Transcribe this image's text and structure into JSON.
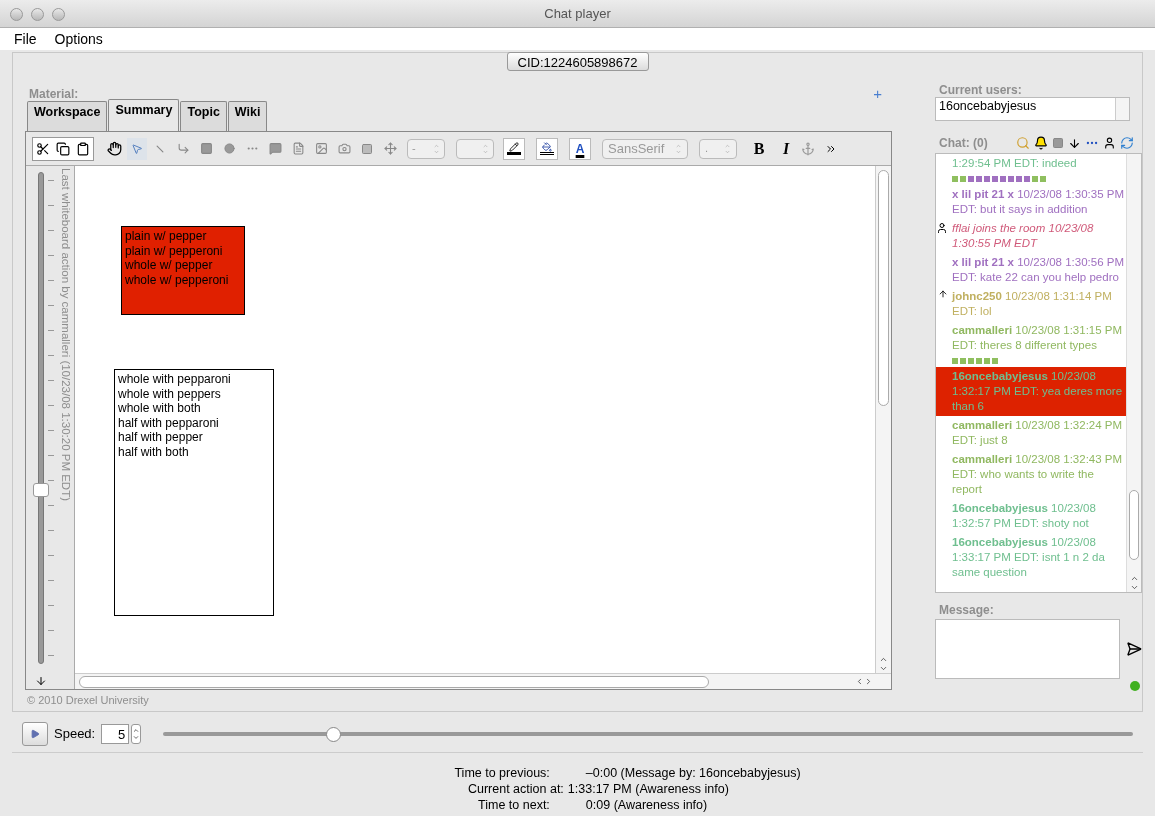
{
  "window": {
    "title": "Chat player"
  },
  "menu": [
    "File",
    "Options"
  ],
  "cid_button": "CID:1224605898672",
  "material": {
    "label": "Material:",
    "add": "+",
    "tabs": [
      {
        "label": "Workspace",
        "selected": false
      },
      {
        "label": "Summary",
        "selected": true
      },
      {
        "label": "Topic",
        "selected": false
      },
      {
        "label": "Wiki",
        "selected": false
      }
    ]
  },
  "toolbar": {
    "line_style": "-",
    "text_color": "A",
    "font": "SansSerif",
    "font_size": ".",
    "bold": "B",
    "italic": "I"
  },
  "timeline": {
    "label": "Last whiteboard action by cammalleri (10/23/08 1:30:20 PM EDT)",
    "level": 0.35
  },
  "canvas": {
    "boxes": [
      {
        "color": "#e02000",
        "lines": [
          "plain w/ pepper",
          "plain w/ pepperoni",
          "whole w/ pepper",
          "whole w/ pepperoni"
        ]
      },
      {
        "color": "#ffffff",
        "lines": [
          "whole with pepparoni",
          "whole with peppers",
          "whole with both",
          "half with pepparoni",
          "half with pepper",
          "half with both"
        ]
      }
    ]
  },
  "copyright": "© 2010 Drexel University",
  "users": {
    "label": "Current users:",
    "items": [
      "16oncebabyjesus"
    ]
  },
  "chat": {
    "label": "Chat: (0)",
    "items": [
      {
        "kind": "fragment",
        "text": "1:29:54 PM EDT: indeed",
        "color": "#6fbf8f",
        "selected": false
      },
      {
        "kind": "separator",
        "squares": [
          {
            "color": "#8fbf5f"
          },
          {
            "color": "#8fbf5f"
          },
          {
            "color": "#a070c0"
          },
          {
            "color": "#a070c0"
          },
          {
            "color": "#a070c0"
          },
          {
            "color": "#a070c0"
          },
          {
            "color": "#a070c0"
          },
          {
            "color": "#a070c0"
          },
          {
            "color": "#a070c0"
          },
          {
            "color": "#a070c0"
          },
          {
            "color": "#8fbf5f"
          },
          {
            "color": "#8fbf5f"
          }
        ]
      },
      {
        "kind": "message",
        "text": "**x lil pit 21 x** 10/23/08 1:30:35 PM EDT: but it says in addition",
        "color": "#a070c0",
        "selected": false
      },
      {
        "kind": "event",
        "text": "fflai joins the room 10/23/08 1:30:55 PM EDT",
        "color": "#d05a7a",
        "selected": false
      },
      {
        "kind": "message",
        "text": "**x lil pit 21 x** 10/23/08 1:30:56 PM EDT: kate 22 can you help pedro",
        "color": "#a070c0",
        "selected": false
      },
      {
        "kind": "reply",
        "text": "**johnc250** 10/23/08 1:31:14 PM EDT: lol",
        "color": "#c0b060",
        "selected": false
      },
      {
        "kind": "message",
        "text": "**cammalleri** 10/23/08 1:31:15 PM EDT: theres 8 different types",
        "color": "#90b860",
        "selected": false
      },
      {
        "kind": "separator",
        "squares": [
          {
            "color": "#8fbf5f"
          },
          {
            "color": "#8fbf5f"
          },
          {
            "color": "#8fbf5f"
          },
          {
            "color": "#8fbf5f"
          },
          {
            "color": "#8fbf5f"
          },
          {
            "color": "#8fbf5f"
          }
        ]
      },
      {
        "kind": "message",
        "text": "**16oncebabyjesus** 10/23/08 1:32:17 PM EDT: yea deres more than 6",
        "color": "#6fbf8f",
        "selected": true
      },
      {
        "kind": "message",
        "text": "**cammalleri** 10/23/08 1:32:24 PM EDT: just 8",
        "color": "#90b860",
        "selected": false
      },
      {
        "kind": "message",
        "text": "**cammalleri** 10/23/08 1:32:43 PM EDT: who wants to write the report",
        "color": "#90b860",
        "selected": false
      },
      {
        "kind": "message",
        "text": "**16oncebabyjesus** 10/23/08 1:32:57 PM EDT: shoty not",
        "color": "#6fbf8f",
        "selected": false
      },
      {
        "kind": "message",
        "text": "**16oncebabyjesus** 10/23/08 1:33:17 PM EDT: isnt 1 n 2 da same question",
        "color": "#6fbf8f",
        "selected": false
      }
    ]
  },
  "message_label": "Message:",
  "playback": {
    "speed_label": "Speed:",
    "speed": "5",
    "level": 0.17
  },
  "info": [
    {
      "label": "Time to previous:",
      "value": "–0:00 (Message by: 16oncebabyjesus)"
    },
    {
      "label": "Current action at:",
      "value": "1:33:17 PM (Awareness info)"
    },
    {
      "label": "Time to next:",
      "value": "0:09 (Awareness info)"
    }
  ]
}
